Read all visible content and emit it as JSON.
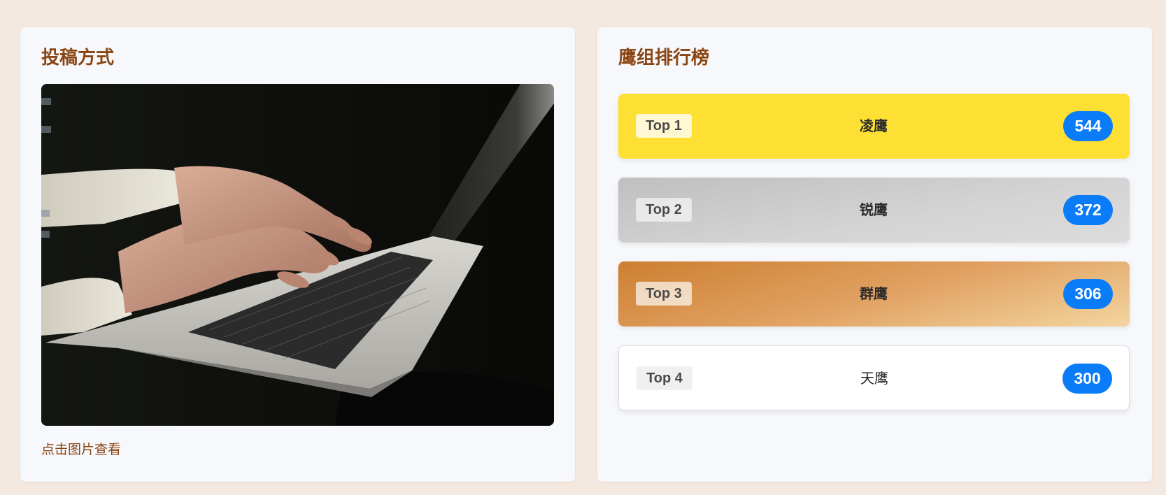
{
  "submission": {
    "title": "投稿方式",
    "image_alt": "person typing on laptop",
    "caption": "点击图片查看"
  },
  "leaderboard": {
    "title": "鹰组排行榜",
    "items": [
      {
        "rank": "Top 1",
        "name": "凌鹰",
        "score": "544"
      },
      {
        "rank": "Top 2",
        "name": "锐鹰",
        "score": "372"
      },
      {
        "rank": "Top 3",
        "name": "群鹰",
        "score": "306"
      },
      {
        "rank": "Top 4",
        "name": "天鹰",
        "score": "300"
      }
    ]
  },
  "colors": {
    "page_background": "#f4e9e1",
    "card_background": "#f6f8fb",
    "title_color": "#8b4513",
    "gold": "#fde033",
    "silver": "#c8c8c8",
    "bronze": "#cd7f32",
    "score_badge": "#0a7cf7"
  }
}
